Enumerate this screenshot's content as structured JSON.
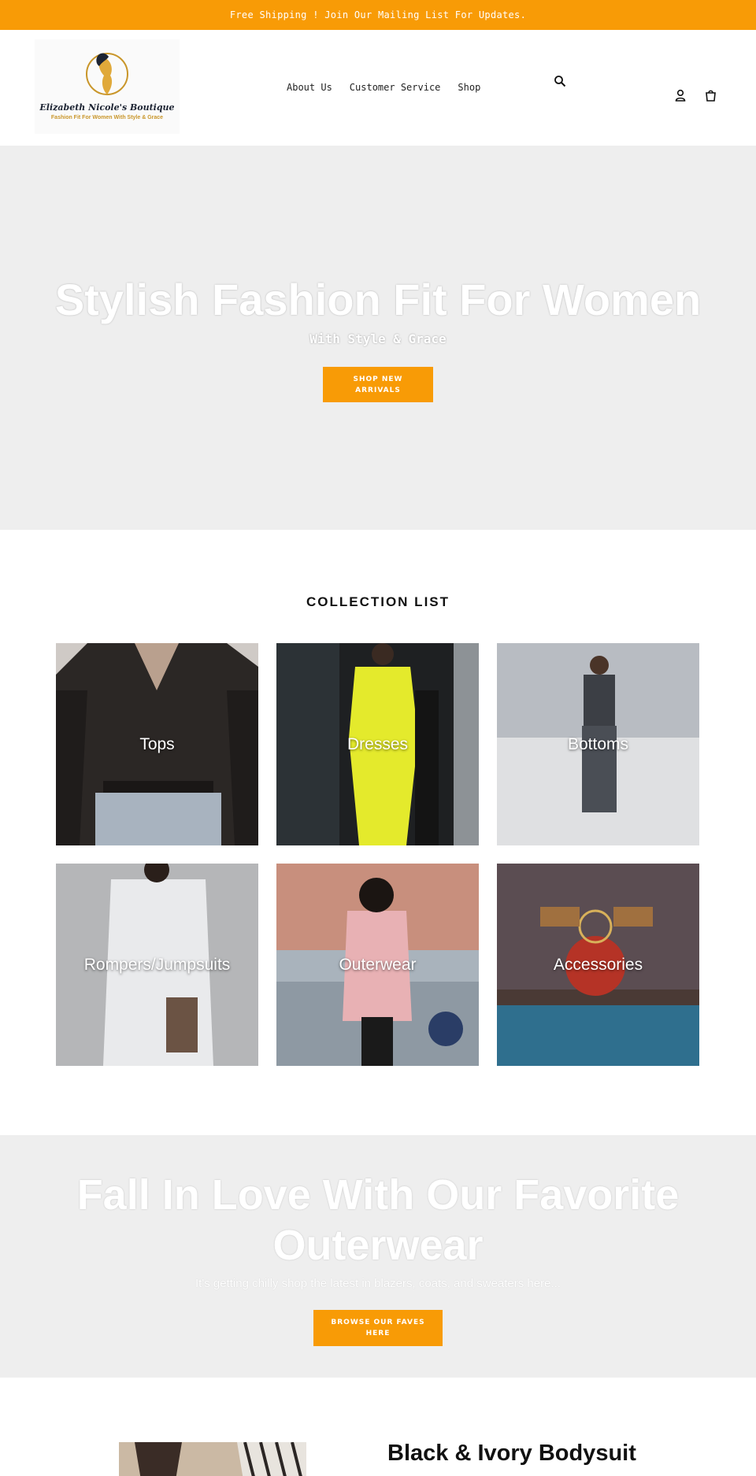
{
  "announcement": {
    "text": "Free Shipping ! Join Our Mailing List For Updates."
  },
  "header": {
    "logo_name": "Elizabeth Nicole's Boutique",
    "logo_tagline": "Fashion Fit For Women With Style & Grace",
    "nav": [
      {
        "label": "About Us"
      },
      {
        "label": "Customer Service"
      },
      {
        "label": "Shop"
      }
    ],
    "icons": {
      "search": "search-icon",
      "account": "account-icon",
      "cart": "cart-icon"
    }
  },
  "hero": {
    "title": "Stylish Fashion Fit For Women",
    "subtitle": "With Style & Grace",
    "button": "SHOP NEW ARRIVALS"
  },
  "collections": {
    "heading": "COLLECTION LIST",
    "items": [
      {
        "label": "Tops"
      },
      {
        "label": "Dresses"
      },
      {
        "label": "Bottoms"
      },
      {
        "label": "Rompers/Jumpsuits"
      },
      {
        "label": "Outerwear"
      },
      {
        "label": "Accessories"
      }
    ]
  },
  "promo": {
    "title_line1": "Fall In Love With Our Favorite",
    "title_line2": "Outerwear",
    "subtitle": "It's getting chilly shop the latest in blazers, coats, and sweaters here...",
    "button": "BROWSE OUR FAVES HERE"
  },
  "featured": {
    "title": "Black & Ivory Bodysuit"
  },
  "colors": {
    "accent": "#f89b06",
    "hero_bg": "#eeeeee"
  }
}
